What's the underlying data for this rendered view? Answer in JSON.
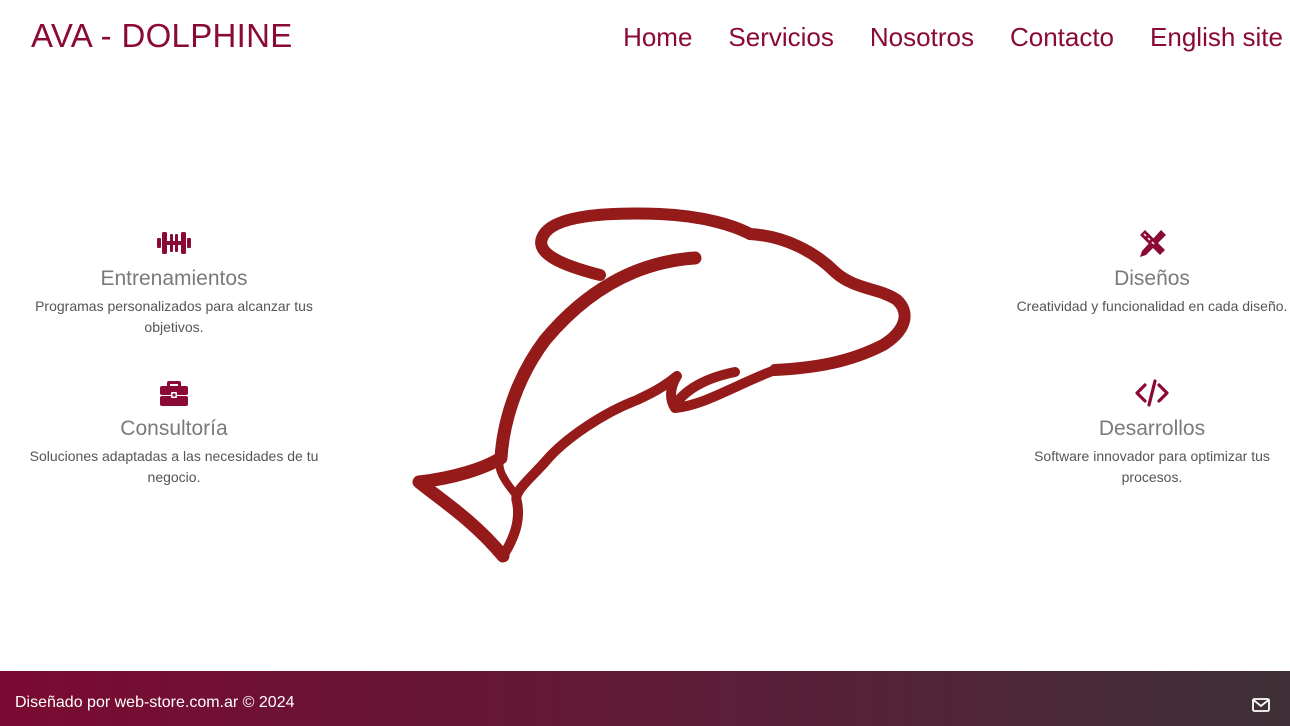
{
  "brand": "AVA - DOLPHINE",
  "nav": {
    "home": "Home",
    "services": "Servicios",
    "about": "Nosotros",
    "contact": "Contacto",
    "english": "English site"
  },
  "services": {
    "training": {
      "title": "Entrenamientos",
      "desc": "Programas personalizados para alcanzar tus objetivos.",
      "icon": "dumbbell-icon"
    },
    "consulting": {
      "title": "Consultoría",
      "desc": "Soluciones adaptadas a las necesidades de tu negocio.",
      "icon": "briefcase-icon"
    },
    "design": {
      "title": "Diseños",
      "desc": "Creatividad y funcionalidad en cada diseño.",
      "icon": "pencil-ruler-icon"
    },
    "development": {
      "title": "Desarrollos",
      "desc": "Software innovador para optimizar tus procesos.",
      "icon": "code-icon"
    }
  },
  "colors": {
    "brand": "#8a0a33",
    "dolphin": "#951a1a",
    "title_gray": "#7a7a7a"
  },
  "footer": {
    "copyright": "Diseñado por web-store.com.ar © 2024",
    "mail_icon": "envelope-icon"
  }
}
